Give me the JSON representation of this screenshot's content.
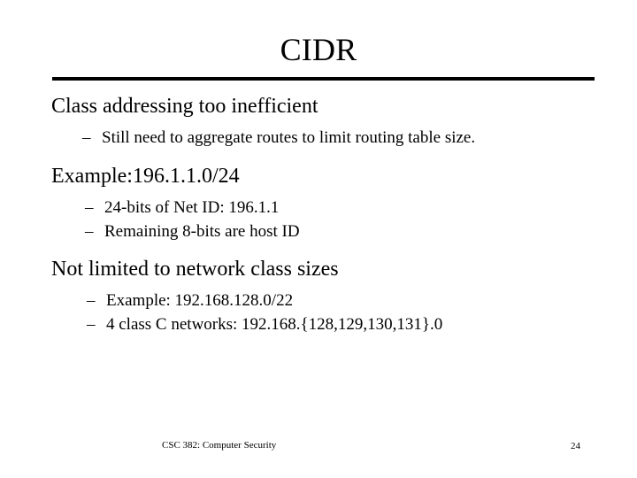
{
  "slide": {
    "title": "CIDR",
    "bullets": [
      {
        "text": "Class addressing too inefficient",
        "sub": [
          {
            "marker": "–",
            "text": "Still need to aggregate routes to limit routing table size."
          }
        ]
      },
      {
        "text": "Example:196.1.1.0/24",
        "sub": [
          {
            "marker": "–",
            "text": "24-bits of Net ID: 196.1.1"
          },
          {
            "marker": "–",
            "text": "Remaining 8-bits are host ID"
          }
        ]
      },
      {
        "text": "Not limited to network class sizes",
        "sub": [
          {
            "marker": "–",
            "text": "Example: 192.168.128.0/22"
          },
          {
            "marker": "–",
            "text": "4 class C networks: 192.168.{128,129,130,131}.0"
          }
        ]
      }
    ],
    "footer": {
      "course": "CSC 382: Computer Security",
      "slide_number": "24"
    },
    "colors": {
      "background": "#ffffff",
      "text": "#000000",
      "rule": "#000000"
    }
  }
}
